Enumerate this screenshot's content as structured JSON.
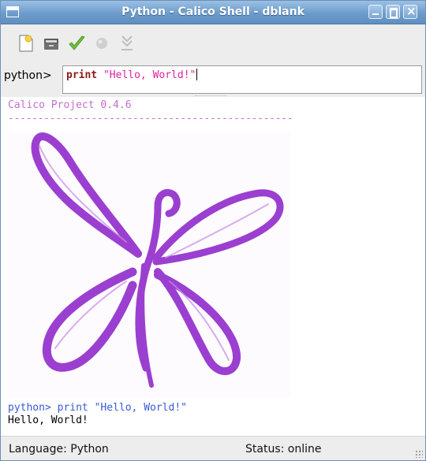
{
  "window": {
    "title": "Python - Calico Shell - dblank"
  },
  "toolbar": {
    "buttons": [
      {
        "name": "new-file",
        "icon": "new-document-icon"
      },
      {
        "name": "open",
        "icon": "folder-icon"
      },
      {
        "name": "run",
        "icon": "checkmark-icon"
      },
      {
        "name": "stop",
        "icon": "stop-icon"
      },
      {
        "name": "debug",
        "icon": "step-icon"
      }
    ]
  },
  "prompt": {
    "label": "python>",
    "keyword": "print",
    "string": "\"Hello, World!\""
  },
  "output": {
    "banner": "Calico Project 0.4.6",
    "rule": "------------------------------------------------",
    "cmd_prompt": "python> ",
    "cmd_code": "print \"Hello, World!\"",
    "result": "Hello, World!"
  },
  "statusbar": {
    "language": "Language: Python",
    "status": "Status: online"
  },
  "colors": {
    "title_bar": "#6d9ccb",
    "banner": "#c46ed0",
    "logo": "#9b3fd0",
    "keyword": "#8b1a1a",
    "string": "#e0219f",
    "command": "#3a5ad6"
  }
}
